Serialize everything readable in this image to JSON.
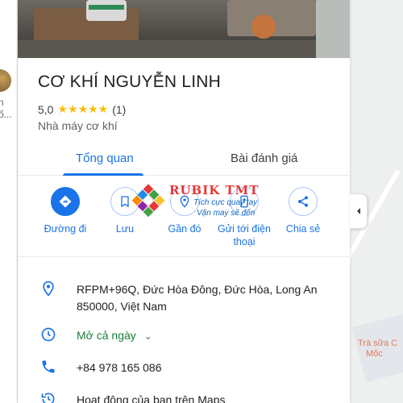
{
  "left_list": {
    "line1": "n",
    "line2": "ố..."
  },
  "place": {
    "name": "CƠ KHÍ NGUYỄN LINH",
    "rating": "5,0",
    "stars": "★★★★★",
    "review_count": "(1)",
    "category": "Nhà máy cơ khí"
  },
  "tabs": [
    {
      "label": "Tổng quan"
    },
    {
      "label": "Bài đánh giá"
    }
  ],
  "actions": [
    {
      "label": "Đường đi",
      "icon": "directions-icon"
    },
    {
      "label": "Lưu",
      "icon": "bookmark-icon"
    },
    {
      "label": "Gần đó",
      "icon": "nearby-icon"
    },
    {
      "label": "Gửi tới điện thoại",
      "icon": "send-to-phone-icon"
    },
    {
      "label": "Chia sẻ",
      "icon": "share-icon"
    }
  ],
  "info": {
    "address": "RFPM+96Q, Đức Hòa Đông, Đức Hòa, Long An 850000, Việt Nam",
    "hours": "Mở cả ngày",
    "phone": "+84 978 165 086",
    "activity": "Hoạt động của bạn trên Maps"
  },
  "watermark": {
    "brand": "RUBIK TMT",
    "tagline1": "Tích cực quay tay",
    "tagline2": "Vận may sẽ đến"
  },
  "map": {
    "label_line1": "Trà sữa C",
    "label_line2": "Mốc"
  },
  "colors": {
    "accent": "#1a73e8",
    "star": "#fbbc04",
    "open_green": "#188038"
  }
}
